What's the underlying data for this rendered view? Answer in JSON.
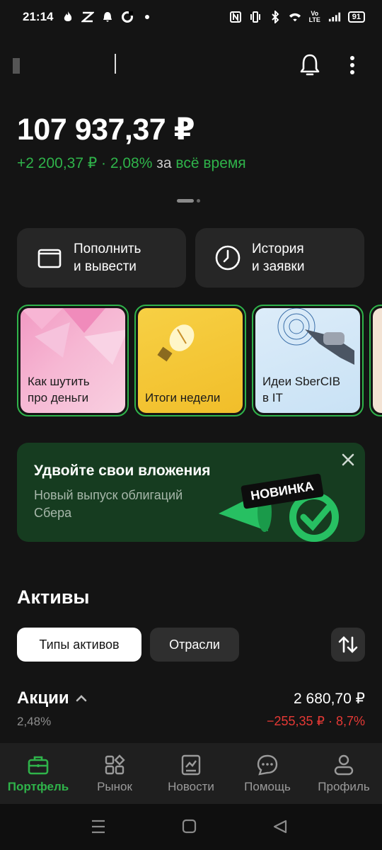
{
  "status_bar": {
    "time": "21:14",
    "battery": "91",
    "left_icons": [
      "flame-icon",
      "app-icon",
      "bell-small-icon",
      "ring-icon",
      "dot-icon"
    ],
    "right_icons": [
      "nfc-icon",
      "vibrate-icon",
      "bluetooth-icon",
      "wifi-icon",
      "volte-icon",
      "signal-icon"
    ]
  },
  "portfolio": {
    "balance": "107 937,37 ₽",
    "gain_amount": "+2 200,37 ₽ · 2,08%",
    "gain_period_prefix": "за",
    "gain_period": "всё время"
  },
  "actions": [
    {
      "label": "Пополнить\nи вывести",
      "icon": "wallet-icon"
    },
    {
      "label": "История\nи заявки",
      "icon": "clock-icon"
    }
  ],
  "stories": [
    {
      "title": "Как шутить\nпро деньги"
    },
    {
      "title": "Итоги недели"
    },
    {
      "title": "Идеи SberCIB\nв IT"
    }
  ],
  "promo": {
    "title": "Удвойте свои вложения",
    "subtitle": "Новый выпуск облигаций Сбера",
    "badge": "НОВИНКА"
  },
  "assets": {
    "title": "Активы",
    "chips": [
      "Типы активов",
      "Отрасли"
    ],
    "rows": [
      {
        "name": "Акции",
        "share": "2,48%",
        "value": "2 680,70 ₽",
        "change": "−255,35 ₽ · 8,7%"
      }
    ]
  },
  "bottom_nav": [
    {
      "label": "Портфель",
      "icon": "briefcase-icon",
      "active": true
    },
    {
      "label": "Рынок",
      "icon": "grid-icon",
      "active": false
    },
    {
      "label": "Новости",
      "icon": "chart-news-icon",
      "active": false
    },
    {
      "label": "Помощь",
      "icon": "chat-icon",
      "active": false
    },
    {
      "label": "Профиль",
      "icon": "person-icon",
      "active": false
    }
  ],
  "colors": {
    "background": "#141414",
    "accent_green": "#2fb34a",
    "negative_red": "#e53935",
    "promo_bg": "#163c20"
  }
}
